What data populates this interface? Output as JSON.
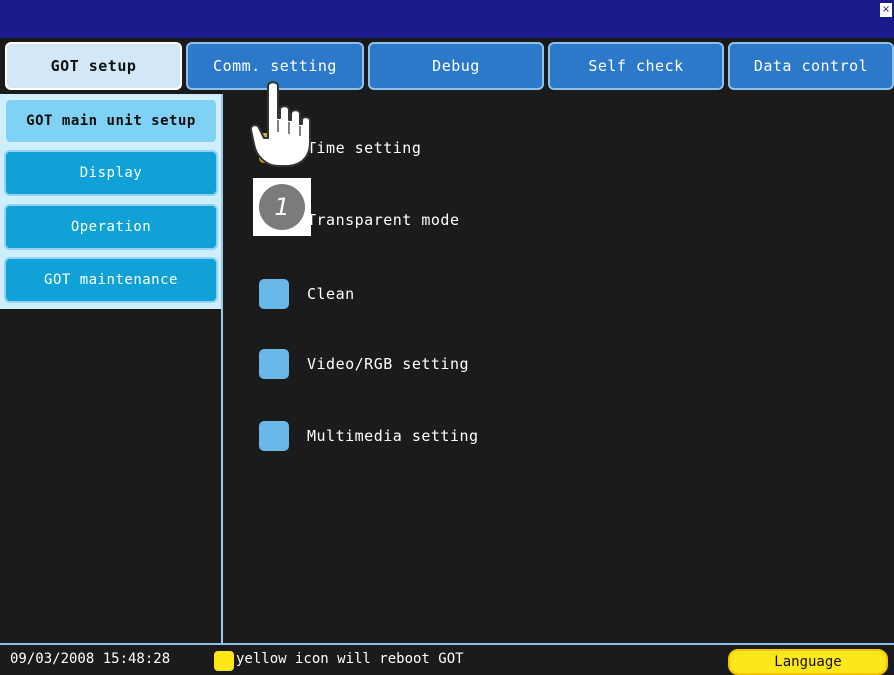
{
  "titlebar": {
    "close_label": "×"
  },
  "tabs": [
    {
      "label": "GOT setup",
      "active": true
    },
    {
      "label": "Comm. setting",
      "active": false
    },
    {
      "label": "Debug",
      "active": false
    },
    {
      "label": "Self check",
      "active": false
    },
    {
      "label": "Data control",
      "active": false
    }
  ],
  "sidebar": {
    "items": [
      {
        "label": "GOT main unit setup",
        "active": true
      },
      {
        "label": "Display",
        "active": false
      },
      {
        "label": "Operation",
        "active": false
      },
      {
        "label": "GOT maintenance",
        "active": false
      }
    ]
  },
  "main": {
    "items": [
      {
        "label": "Time setting",
        "icon": "square-orange"
      },
      {
        "label": "Transparent mode",
        "icon": "square-blue"
      },
      {
        "label": "Clean",
        "icon": "square-blue"
      },
      {
        "label": "Video/RGB setting",
        "icon": "square-blue"
      },
      {
        "label": "Multimedia setting",
        "icon": "square-blue"
      }
    ],
    "step_badge": "1",
    "pointer_icon": "pointing-hand-icon"
  },
  "statusbar": {
    "datetime": "09/03/2008 15:48:28",
    "notice": "yellow icon will reboot GOT",
    "language_label": "Language"
  },
  "colors": {
    "titlebar": "#1a1a8a",
    "tab": "#2b79c8",
    "tab_active": "#d2e8f7",
    "side_button": "#10a2d6",
    "side_button_active": "#7fd2f3",
    "item_square": "#6ab7ea",
    "reboot_yellow": "#fde61a"
  }
}
